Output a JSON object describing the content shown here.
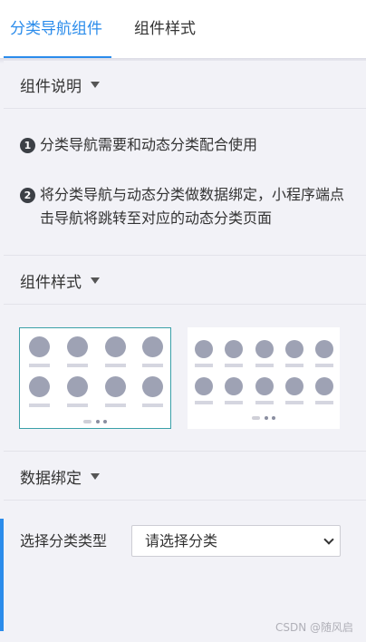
{
  "tabs": [
    {
      "label": "分类导航组件",
      "active": true
    },
    {
      "label": "组件样式",
      "active": false
    }
  ],
  "sections": {
    "description": {
      "title": "组件说明"
    },
    "style": {
      "title": "组件样式"
    },
    "binding": {
      "title": "数据绑定"
    }
  },
  "description": {
    "items": [
      {
        "number": "1",
        "text": "分类导航需要和动态分类配合使用"
      },
      {
        "number": "2",
        "text": "将分类导航与动态分类做数据绑定，小程序端点击导航将跳转至对应的动态分类页面"
      }
    ]
  },
  "style_options": [
    {
      "columns": 4,
      "rows": 2,
      "selected": true
    },
    {
      "columns": 5,
      "rows": 2,
      "selected": false
    }
  ],
  "binding": {
    "label": "选择分类类型",
    "select_value": "请选择分类"
  },
  "watermark": "CSDN @随风启",
  "colors": {
    "accent": "#2b8ceb",
    "selected_border": "#3aa0a8",
    "placeholder_dot": "#9ea2b4"
  }
}
